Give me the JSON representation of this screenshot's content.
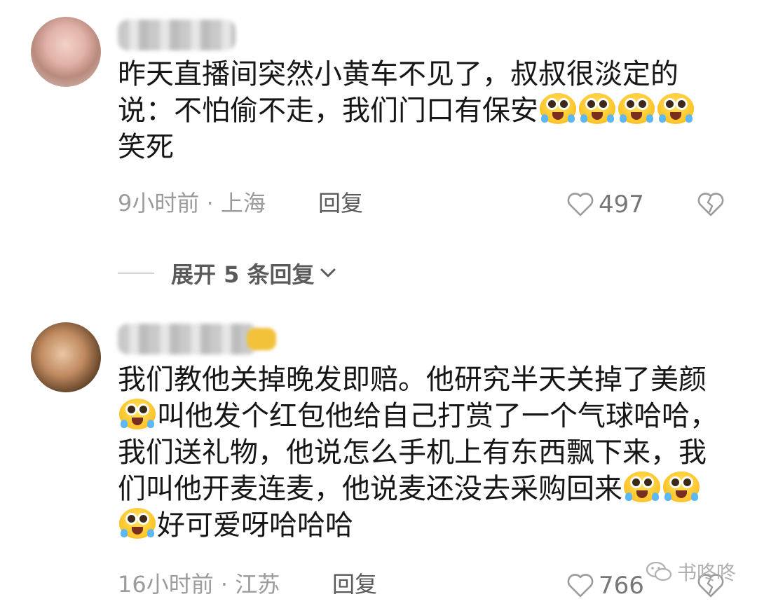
{
  "comments": [
    {
      "text_parts": [
        "昨天直播间突然小黄车不见了，叔叔很淡定的说：不怕偷不走，我们门口有保安",
        "笑死"
      ],
      "meta": "9小时前 · 上海",
      "reply_label": "回复",
      "likes": "497"
    },
    {
      "text_parts": [
        "我们教他关掉晚发即赔。他研究半天关掉了美颜",
        "叫他发个红包他给自己打赏了一个气球哈哈，我们送礼物，他说怎么手机上有东西飘下来，我们叫他开麦连麦，他说麦还没去采购回来",
        "好可爱呀哈哈哈"
      ],
      "meta": "16小时前 · 江苏",
      "reply_label": "回复",
      "likes": "766"
    }
  ],
  "expand_replies": {
    "label": "展开 5 条回复"
  },
  "watermark": {
    "text": "书咚咚"
  },
  "icons": {
    "emoji": "crying-laughing-emoji",
    "like": "heart-outline-icon",
    "dislike": "broken-heart-icon",
    "expand": "chevron-down-icon",
    "watermark": "wechat-icon"
  },
  "colors": {
    "meta_text": "#9b9b9b",
    "body_text": "#161616",
    "emoji_yellow": "#ffc62e"
  }
}
